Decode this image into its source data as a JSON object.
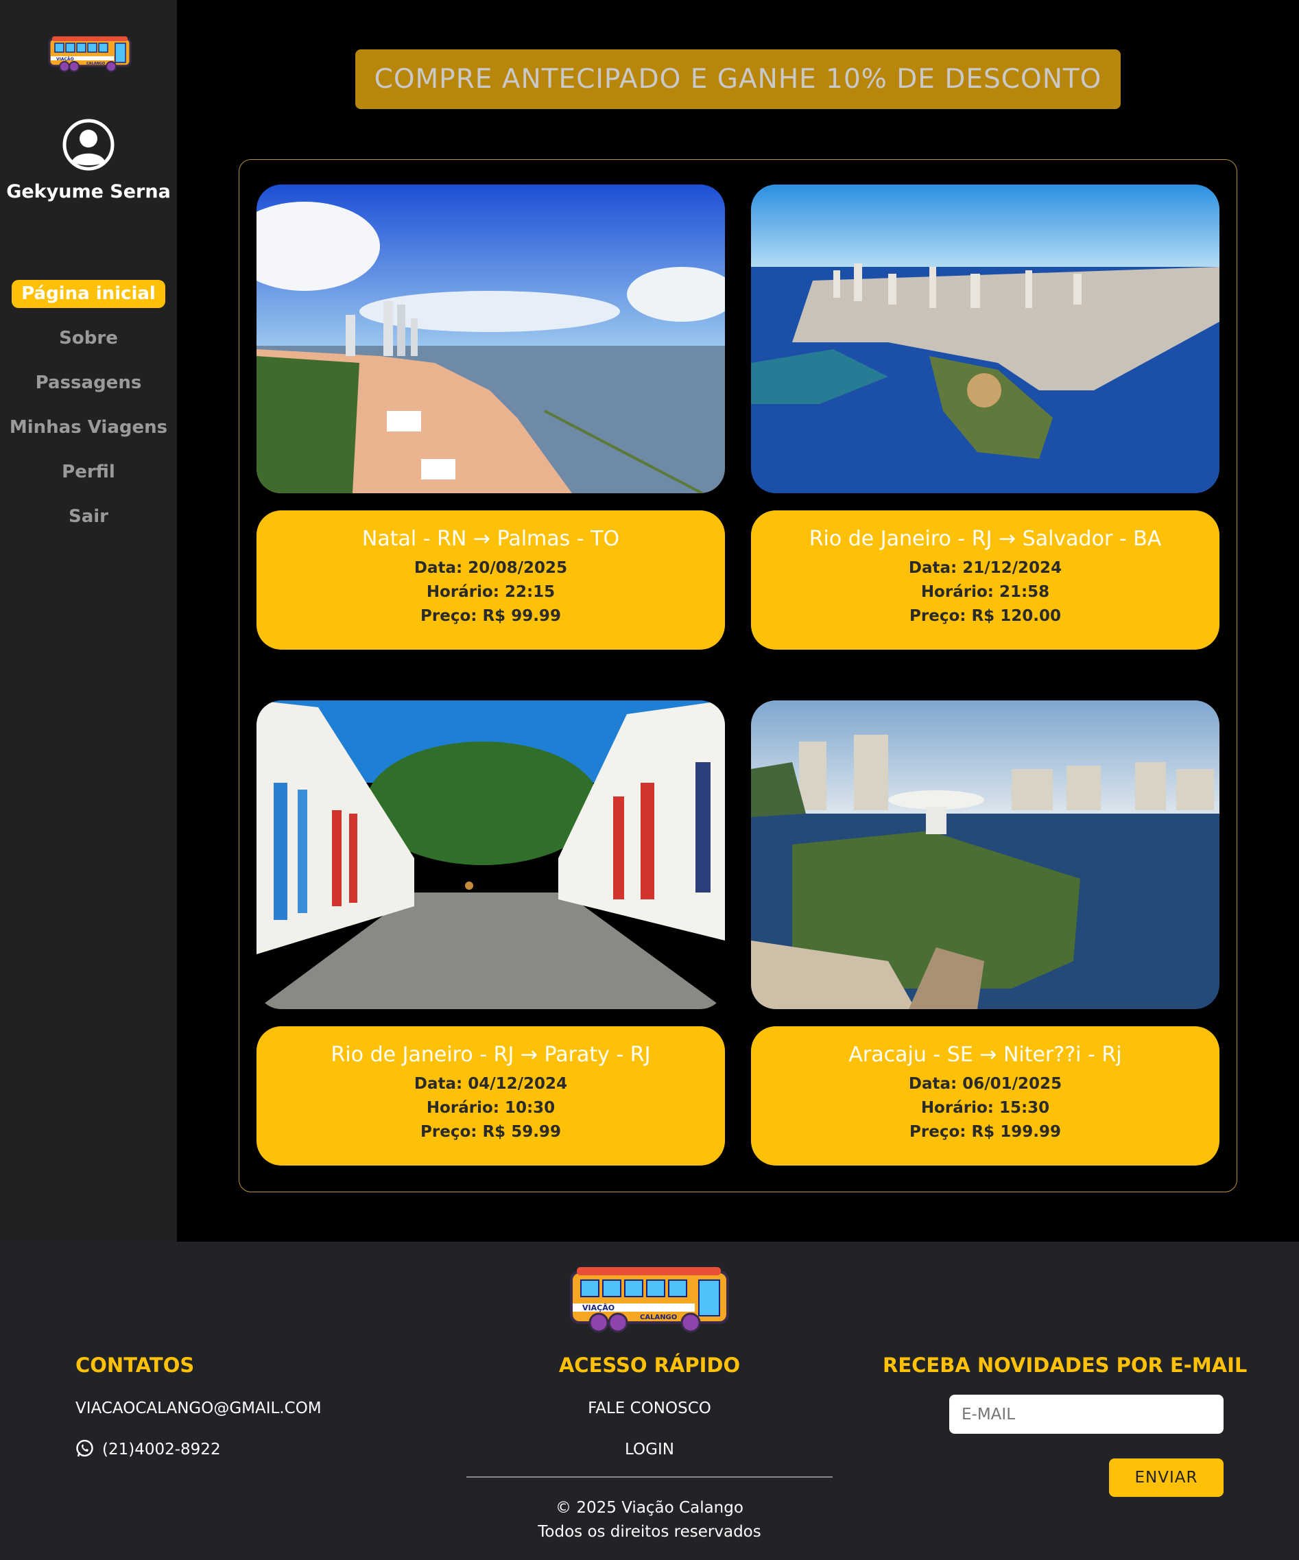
{
  "user": {
    "name": "Gekyume Serna"
  },
  "nav": [
    {
      "label": "Página inicial",
      "active": true
    },
    {
      "label": "Sobre"
    },
    {
      "label": "Passagens"
    },
    {
      "label": "Minhas Viagens"
    },
    {
      "label": "Perfil"
    },
    {
      "label": "Sair"
    }
  ],
  "promo": {
    "text": "COMPRE ANTECIPADO E GANHE 10% DE DESCONTO"
  },
  "trips": [
    {
      "route": "Natal - RN → Palmas - TO",
      "date": "Data: 20/08/2025",
      "time": "Horário: 22:15",
      "price": "Preço: R$ 99.99"
    },
    {
      "route": "Rio de Janeiro - RJ → Salvador - BA",
      "date": "Data: 21/12/2024",
      "time": "Horário: 21:58",
      "price": "Preço: R$ 120.00"
    },
    {
      "route": "Rio de Janeiro - RJ → Paraty - RJ",
      "date": "Data: 04/12/2024",
      "time": "Horário: 10:30",
      "price": "Preço: R$ 59.99"
    },
    {
      "route": "Aracaju - SE → Niter??i - Rj",
      "date": "Data: 06/01/2025",
      "time": "Horário: 15:30",
      "price": "Preço: R$ 199.99"
    }
  ],
  "brand": {
    "line1": "VIAÇÃO",
    "line2": "CALANGO"
  },
  "footer": {
    "contacts_title": "CONTATOS",
    "email": "VIACAOCALANGO@GMAIL.COM",
    "phone": "(21)4002-8922",
    "quick_title": "ACESSO RÁPIDO",
    "contact_link": "FALE CONOSCO",
    "login_link": "LOGIN",
    "copyright": "© 2025 Viação Calango",
    "rights": "Todos os direitos reservados",
    "newsletter_title": "RECEBA NOVIDADES POR E-MAIL",
    "email_placeholder": "E-MAIL",
    "send_label": "ENVIAR"
  },
  "colors": {
    "accent": "#ffc107",
    "sidebar": "#212121",
    "footer": "#212327",
    "promo": "#b8860b"
  }
}
